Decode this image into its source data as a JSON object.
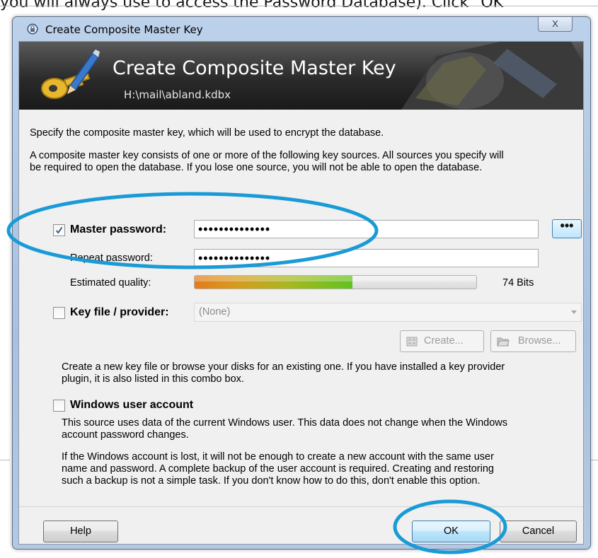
{
  "background_text": "you will always use to access the Password Database).  Click \"OK\"",
  "window": {
    "title": "Create Composite Master Key",
    "close_symbol": "X",
    "icon": "lock-icon"
  },
  "banner": {
    "title": "Create Composite Master Key",
    "subtitle": "H:\\mail\\abland.kdbx",
    "icon": "key-pencil-icon"
  },
  "intro": {
    "line1": "Specify the composite master key, which will be used to encrypt the database.",
    "line2a": "A composite master key consists of one or more of the following key sources. All sources you specify will",
    "line2b": "be required to open the database.  If you lose one source, you will not be able to open the database."
  },
  "master_password": {
    "checked": true,
    "label": "Master password:",
    "value": "••••••••••••••",
    "toggle_label": "•••"
  },
  "repeat_password": {
    "label": "Repeat password:",
    "value": "••••••••••••••"
  },
  "quality": {
    "label": "Estimated quality:",
    "value_text": "74 Bits",
    "fill_fraction": 0.56
  },
  "key_file": {
    "checked": false,
    "label": "Key file / provider:",
    "selected": "(None)",
    "create_label": "Create...",
    "browse_label": "Browse...",
    "desc_a": "Create a new key file or browse your disks for an existing one. If you have installed a key provider",
    "desc_b": "plugin, it is also listed in this combo box."
  },
  "windows_account": {
    "checked": false,
    "label": "Windows user account",
    "desc1a": "This source uses data of the current Windows user. This data does not change when the Windows",
    "desc1b": "account password changes.",
    "desc2a": "If the Windows account is lost, it will not be enough to create a new account with the same user",
    "desc2b": "name and password. A complete backup of the user account is required. Creating and restoring",
    "desc2c": "such a backup is not a simple task. If you don't know how to do this, don't enable this option."
  },
  "footer": {
    "help_label": "Help",
    "ok_label": "OK",
    "cancel_label": "Cancel"
  },
  "colors": {
    "highlight_ellipse": "#1a9ad6",
    "banner_bg": "#2a2a2a",
    "window_frame": "#b4c8e2"
  }
}
